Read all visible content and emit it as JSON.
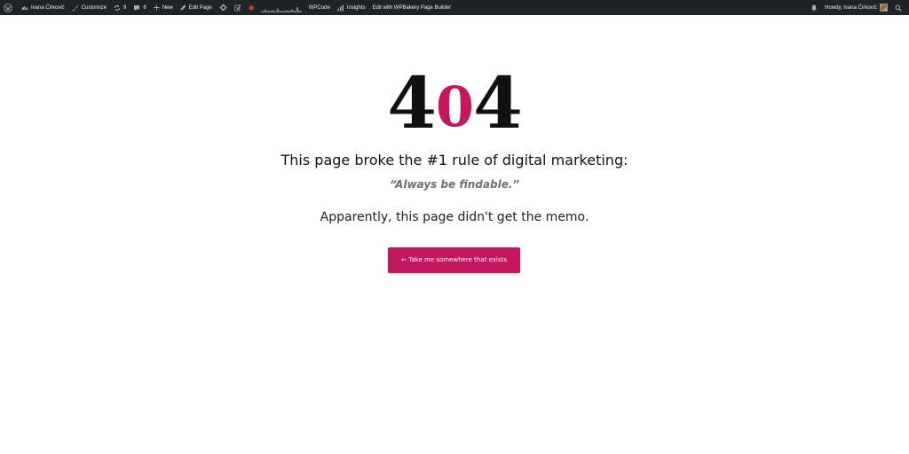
{
  "admin_bar": {
    "site_name": "Ivana Ćirković",
    "customize_label": "Customize",
    "updates_count": "9",
    "comments_count": "6",
    "new_label": "New",
    "edit_page_label": "Edit Page",
    "wpcode_label": "WPCode",
    "insights_label": "Insights",
    "wpbakery_label": "Edit with WPBakery Page Builder",
    "howdy_label": "Howdy, Ivana Ćirković",
    "icons": {
      "wordpress": "wordpress-logo-icon",
      "site": "dashboard-icon",
      "customize": "brush-icon",
      "updates": "updates-icon",
      "comments": "comment-bubble-icon",
      "new": "plus-icon",
      "edit": "pencil-icon",
      "plugin": "diamond-icon",
      "yoast": "yoast-icon",
      "status": "red-dot-icon",
      "sparkline": "stats-sparkline-icon",
      "insights": "bar-chart-icon",
      "notification": "bell-icon",
      "search": "search-icon"
    },
    "colors": {
      "background": "#1d2327",
      "text": "#f0f0f1",
      "status_dot": "#d63638"
    }
  },
  "error_page": {
    "code_digit_1": "4",
    "code_digit_2": "0",
    "code_digit_3": "4",
    "headline": "This page broke the #1 rule of digital marketing:",
    "quote": "“Always be findable.”",
    "memo": "Apparently, this page didn't get the memo.",
    "cta_label": "← Take me somewhere that exists",
    "colors": {
      "accent": "#c4185e",
      "heading": "#111111",
      "quote": "#6e6e6e"
    }
  }
}
